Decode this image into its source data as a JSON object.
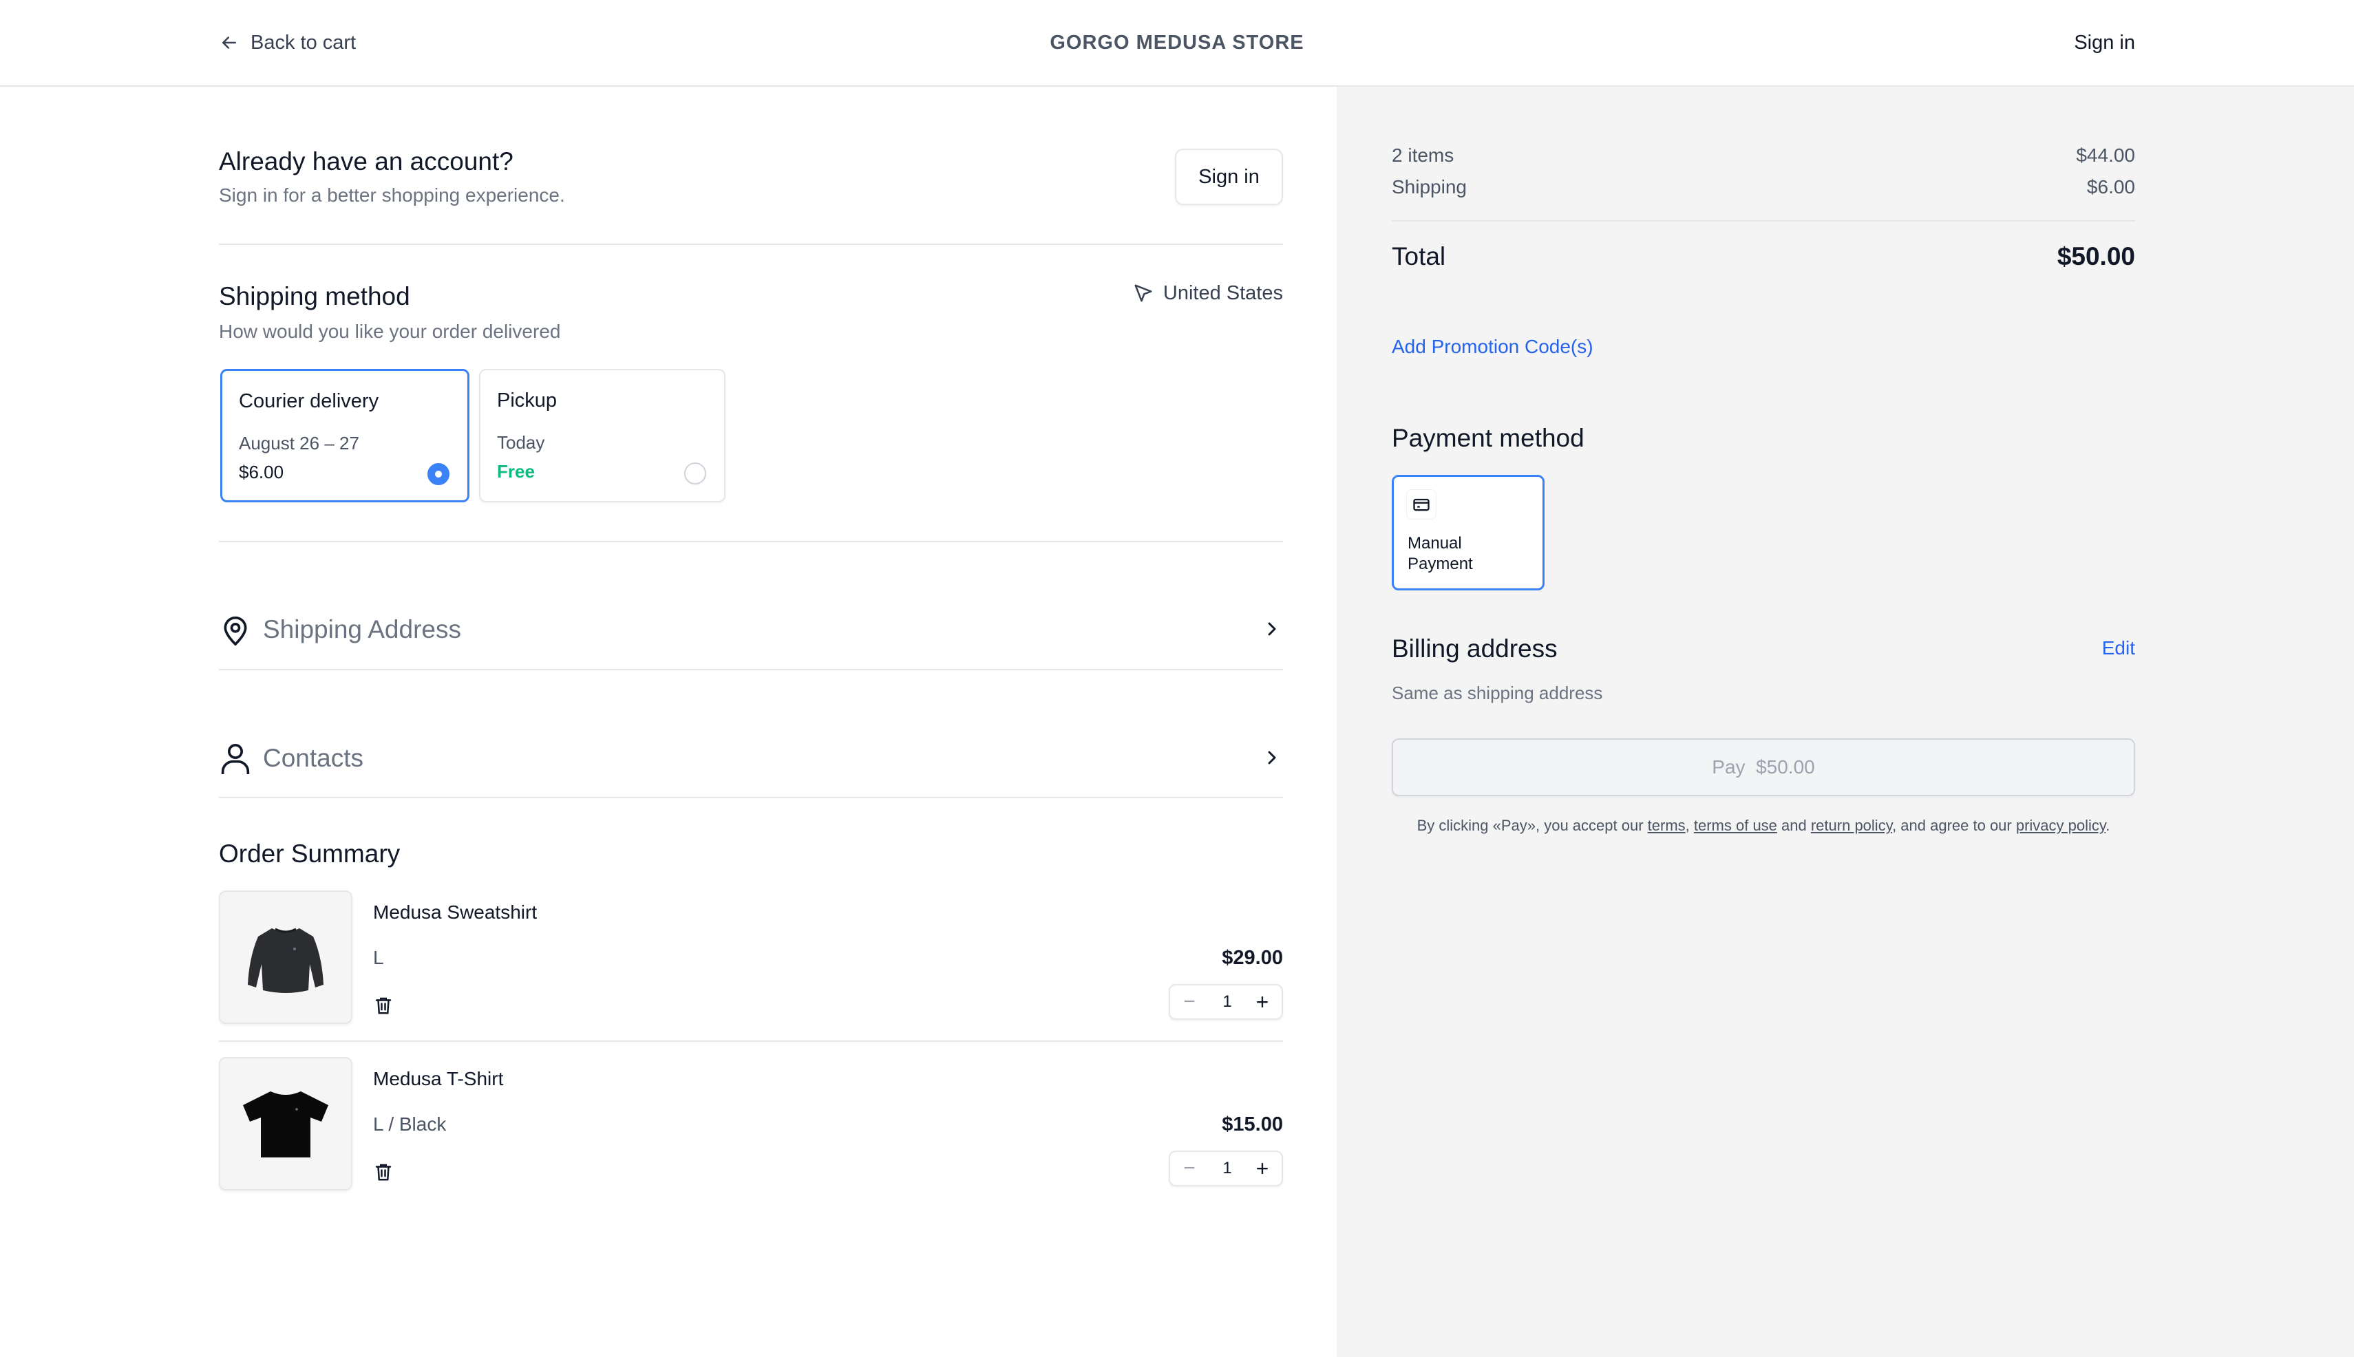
{
  "header": {
    "back_label": "Back to cart",
    "store_name": "GORGO MEDUSA STORE",
    "signin_label": "Sign in"
  },
  "account": {
    "title": "Already have an account?",
    "subtitle": "Sign in for a better shopping experience.",
    "signin_button": "Sign in"
  },
  "shipping": {
    "title": "Shipping method",
    "subtitle": "How would you like your order delivered",
    "country": "United States",
    "options": [
      {
        "name": "Courier delivery",
        "date": "August 26 – 27",
        "price": "$6.00",
        "selected": true
      },
      {
        "name": "Pickup",
        "date": "Today",
        "price": "Free",
        "selected": false
      }
    ]
  },
  "sections": {
    "shipping_address": "Shipping Address",
    "contacts": "Contacts"
  },
  "order_summary": {
    "title": "Order Summary",
    "items": [
      {
        "name": "Medusa Sweatshirt",
        "variant": "L",
        "price": "$29.00",
        "quantity": "1"
      },
      {
        "name": "Medusa T-Shirt",
        "variant": "L / Black",
        "price": "$15.00",
        "quantity": "1"
      }
    ]
  },
  "totals": {
    "items_label": "2 items",
    "items_value": "$44.00",
    "shipping_label": "Shipping",
    "shipping_value": "$6.00",
    "total_label": "Total",
    "total_value": "$50.00",
    "promo_label": "Add Promotion Code(s)"
  },
  "payment": {
    "title": "Payment method",
    "method_line1": "Manual",
    "method_line2": "Payment",
    "icon": "credit-card-icon"
  },
  "billing": {
    "title": "Billing address",
    "edit_label": "Edit",
    "subtitle": "Same as shipping address"
  },
  "pay": {
    "label": "Pay",
    "amount": "$50.00"
  },
  "legal": {
    "part1": "By clicking «Pay», you accept our ",
    "terms": "terms",
    "sep1": ", ",
    "terms_of_use": "terms of use",
    "sep2": " and ",
    "return_policy": "return policy",
    "part2": ", and agree to our ",
    "privacy_policy": "privacy policy",
    "end": "."
  },
  "colors": {
    "accent": "#3b82f6",
    "link": "#2563eb",
    "free": "#10b981",
    "panel_bg": "#f4f4f5"
  }
}
